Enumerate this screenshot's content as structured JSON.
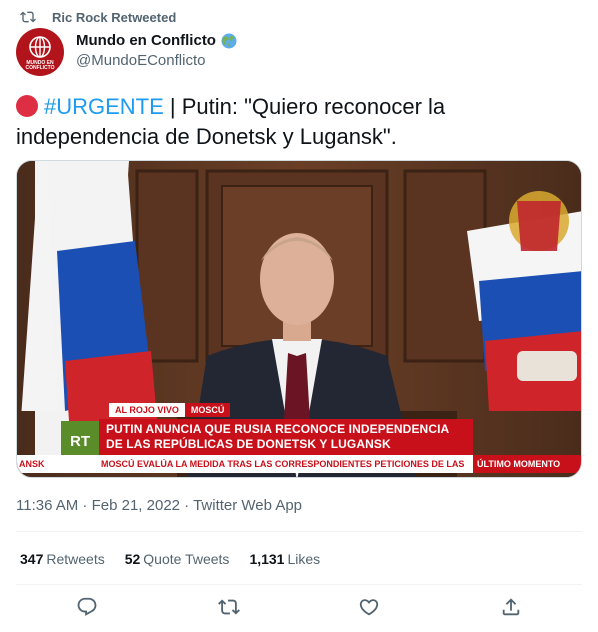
{
  "retweet": {
    "text": "Ric Rock Retweeted",
    "icon": "retweet-icon"
  },
  "author": {
    "display_name": "Mundo en Conflicto",
    "handle": "@MundoEConflicto",
    "badge_icon": "earth-globe-icon",
    "avatar_text": "MUNDO EN CONFLICTO"
  },
  "tweet": {
    "hashtag": "#URGENTE",
    "text": " | Putin: \"Quiero reconocer la independencia de Donetsk y Lugansk\"."
  },
  "media": {
    "tag_live": "AL ROJO VIVO",
    "tag_city": "MOSCÚ",
    "channel_badge": "RT",
    "headline_line1": "PUTIN ANUNCIA QUE RUSIA RECONOCE INDEPENDENCIA",
    "headline_line2": "DE LAS REPÚBLICAS DE DONETSK Y LUGANSK",
    "ticker_left": "ANSK",
    "ticker_main": "MOSCÚ EVALÚA LA MEDIDA TRAS LAS CORRESPONDIENTES PETICIONES DE LAS",
    "ticker_right": "ÚLTIMO MOMENTO"
  },
  "meta": {
    "time": "11:36 AM",
    "date": "Feb 21, 2022",
    "source": "Twitter Web App",
    "separator": " · "
  },
  "stats": [
    {
      "count": "347",
      "label": "Retweets"
    },
    {
      "count": "52",
      "label": "Quote Tweets"
    },
    {
      "count": "1,131",
      "label": "Likes"
    }
  ],
  "actions": [
    "reply-icon",
    "retweet-icon",
    "like-icon",
    "share-icon"
  ],
  "colors": {
    "accent": "#1d9bf0",
    "secondary_text": "#536471",
    "rt_red": "#c8101b",
    "urgent_dot": "#dd2e44"
  }
}
